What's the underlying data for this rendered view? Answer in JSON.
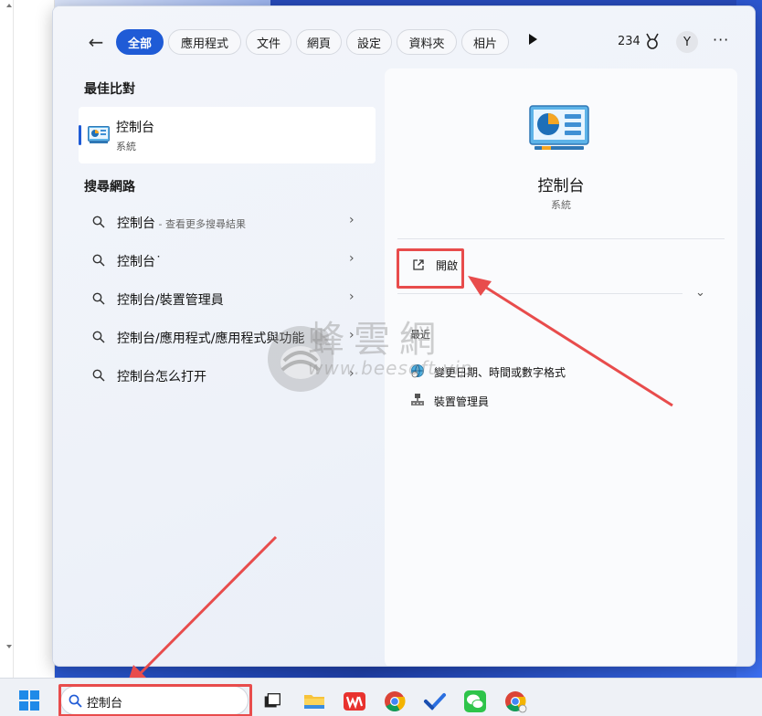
{
  "filters": {
    "chips": [
      "全部",
      "應用程式",
      "文件",
      "網頁",
      "設定",
      "資料夾",
      "相片"
    ],
    "active_index": 0,
    "points": "234",
    "avatar_letter": "Y",
    "more": "···"
  },
  "left": {
    "best_match_title": "最佳比對",
    "best_match": {
      "name": "控制台",
      "type": "系統"
    },
    "web_title": "搜尋網路",
    "web_items": [
      {
        "text": "控制台",
        "hint": " - 查看更多搜尋結果"
      },
      {
        "text": "控制台˙",
        "hint": ""
      },
      {
        "text": "控制台/裝置管理員",
        "hint": ""
      },
      {
        "text": "控制台/應用程式/應用程式與功能",
        "hint": ""
      },
      {
        "text": "控制台怎么打开",
        "hint": ""
      }
    ]
  },
  "preview": {
    "app_name": "控制台",
    "app_type": "系統",
    "open_label": "開啟",
    "recent_title": "最近",
    "recent_items": [
      "變更日期、時間或數字格式",
      "裝置管理員"
    ]
  },
  "watermark": {
    "brand": "蜂雲網",
    "url": "www.beesoft.vip"
  },
  "taskbar": {
    "search_value": "控制台"
  },
  "colors": {
    "accent": "#1f5bd6",
    "annotation_red": "#e84c4c"
  },
  "icons": {
    "back": "arrow-left-icon",
    "search": "search-icon",
    "chevron": "chevron-right-icon",
    "external": "open-external-icon"
  }
}
